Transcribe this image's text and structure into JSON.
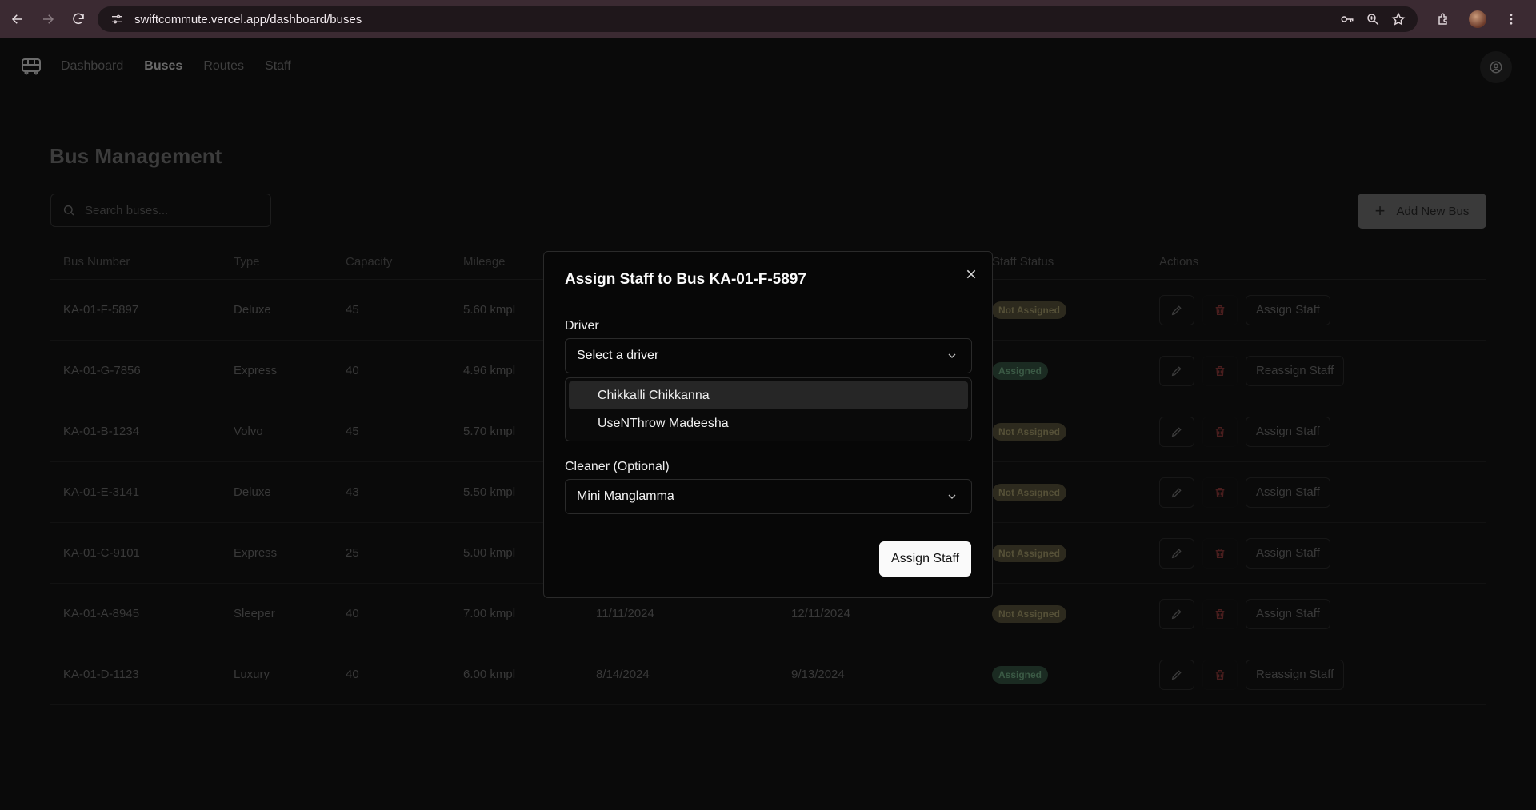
{
  "browser": {
    "url": "swiftcommute.vercel.app/dashboard/buses"
  },
  "nav": {
    "links": [
      "Dashboard",
      "Buses",
      "Routes",
      "Staff"
    ],
    "active": "Buses"
  },
  "page": {
    "title": "Bus Management",
    "search_placeholder": "Search buses...",
    "add_button": "Add New Bus"
  },
  "table": {
    "headers": [
      "Bus Number",
      "Type",
      "Capacity",
      "Mileage",
      "",
      "",
      "Staff Status",
      "Actions"
    ],
    "rows": [
      {
        "bus": "KA-01-F-5897",
        "type": "Deluxe",
        "capacity": "45",
        "mileage": "5.60 kmpl",
        "date1": "",
        "date2": "",
        "status": "Not Assigned",
        "assigned": false,
        "action": "Assign Staff"
      },
      {
        "bus": "KA-01-G-7856",
        "type": "Express",
        "capacity": "40",
        "mileage": "4.96 kmpl",
        "date1": "",
        "date2": "",
        "status": "Assigned",
        "assigned": true,
        "action": "Reassign Staff"
      },
      {
        "bus": "KA-01-B-1234",
        "type": "Volvo",
        "capacity": "45",
        "mileage": "5.70 kmpl",
        "date1": "",
        "date2": "",
        "status": "Not Assigned",
        "assigned": false,
        "action": "Assign Staff"
      },
      {
        "bus": "KA-01-E-3141",
        "type": "Deluxe",
        "capacity": "43",
        "mileage": "5.50 kmpl",
        "date1": "",
        "date2": "",
        "status": "Not Assigned",
        "assigned": false,
        "action": "Assign Staff"
      },
      {
        "bus": "KA-01-C-9101",
        "type": "Express",
        "capacity": "25",
        "mileage": "5.00 kmpl",
        "date1": "",
        "date2": "",
        "status": "Not Assigned",
        "assigned": false,
        "action": "Assign Staff"
      },
      {
        "bus": "KA-01-A-8945",
        "type": "Sleeper",
        "capacity": "40",
        "mileage": "7.00 kmpl",
        "date1": "11/11/2024",
        "date2": "12/11/2024",
        "status": "Not Assigned",
        "assigned": false,
        "action": "Assign Staff"
      },
      {
        "bus": "KA-01-D-1123",
        "type": "Luxury",
        "capacity": "40",
        "mileage": "6.00 kmpl",
        "date1": "8/14/2024",
        "date2": "9/13/2024",
        "status": "Assigned",
        "assigned": true,
        "action": "Reassign Staff"
      }
    ]
  },
  "modal": {
    "title": "Assign Staff to Bus KA-01-F-5897",
    "driver_label": "Driver",
    "driver_value": "Select a driver",
    "driver_options": [
      "Chikkalli Chikkanna",
      "UseNThrow Madeesha"
    ],
    "cleaner_label": "Cleaner (Optional)",
    "cleaner_value": "Mini Manglamma",
    "submit": "Assign Staff"
  }
}
